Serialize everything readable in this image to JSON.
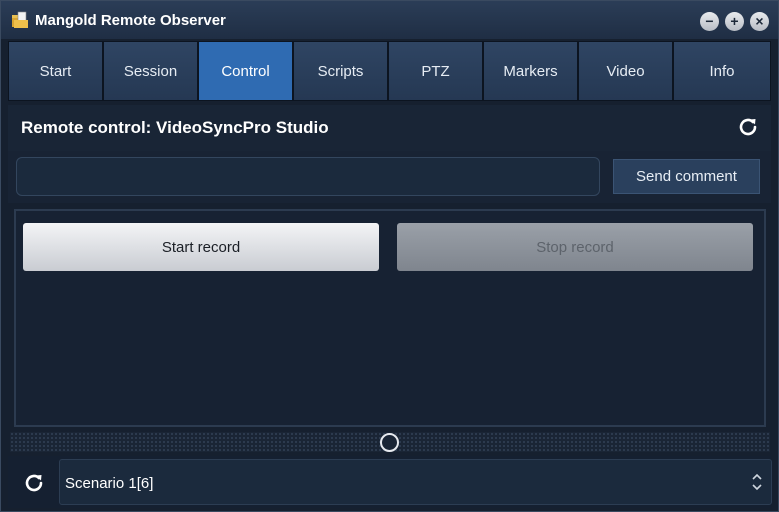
{
  "window": {
    "title": "Mangold Remote Observer",
    "app_icon": "folder-icon",
    "controls": {
      "minimize": "−",
      "maximize": "+",
      "close": "×"
    }
  },
  "tabs": [
    {
      "label": "Start",
      "active": false
    },
    {
      "label": "Session",
      "active": false
    },
    {
      "label": "Control",
      "active": true
    },
    {
      "label": "Scripts",
      "active": false
    },
    {
      "label": "PTZ",
      "active": false
    },
    {
      "label": "Markers",
      "active": false
    },
    {
      "label": "Video",
      "active": false
    },
    {
      "label": "Info",
      "active": false
    }
  ],
  "header": {
    "title": "Remote control: VideoSyncPro Studio",
    "refresh_icon": "refresh-icon"
  },
  "comment": {
    "value": "",
    "placeholder": "",
    "send_label": "Send comment"
  },
  "record": {
    "start_label": "Start record",
    "stop_label": "Stop record",
    "stop_enabled": false
  },
  "bottom": {
    "scenario_value": "Scenario 1[6]",
    "refresh_icon": "refresh-icon",
    "arrows_icon": "updown-arrows-icon"
  },
  "colors": {
    "active_tab": "#2f6bb2",
    "tab": "#2a3e5a",
    "background": "#16202f"
  }
}
